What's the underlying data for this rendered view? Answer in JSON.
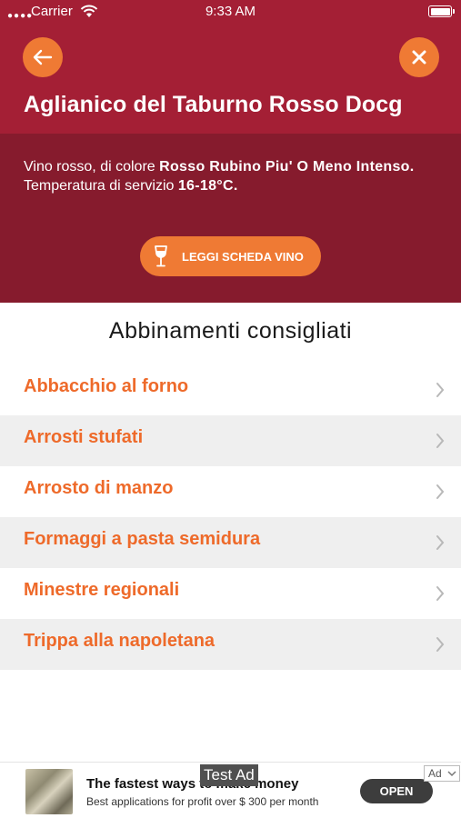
{
  "status_bar": {
    "carrier": "Carrier",
    "time": "9:33 AM"
  },
  "header": {
    "title": "Aglianico del Taburno Rosso Docg"
  },
  "info": {
    "line1_prefix": "Vino rosso, di colore ",
    "color_value": "Rosso Rubino Piu' O Meno Intenso.",
    "line2_prefix": "Temperatura di servizio ",
    "temperature_value": "16-18°C.",
    "button_label": "LEGGI SCHEDA VINO"
  },
  "pairings": {
    "title": "Abbinamenti consigliati",
    "items": [
      {
        "label": "Abbacchio al forno"
      },
      {
        "label": "Arrosti stufati"
      },
      {
        "label": "Arrosto di manzo"
      },
      {
        "label": "Formaggi a pasta semidura"
      },
      {
        "label": "Minestre regionali"
      },
      {
        "label": "Trippa alla napoletana"
      }
    ]
  },
  "ad": {
    "test_label": "Test Ad",
    "headline": "The fastest ways to make money",
    "subtext": "Best applications for profit over $ 300 per month",
    "cta": "OPEN",
    "badge": "Ad"
  },
  "colors": {
    "header": "#a41f35",
    "info_panel": "#861b2d",
    "accent": "#ef7a34",
    "list_text": "#ee6a2a"
  }
}
